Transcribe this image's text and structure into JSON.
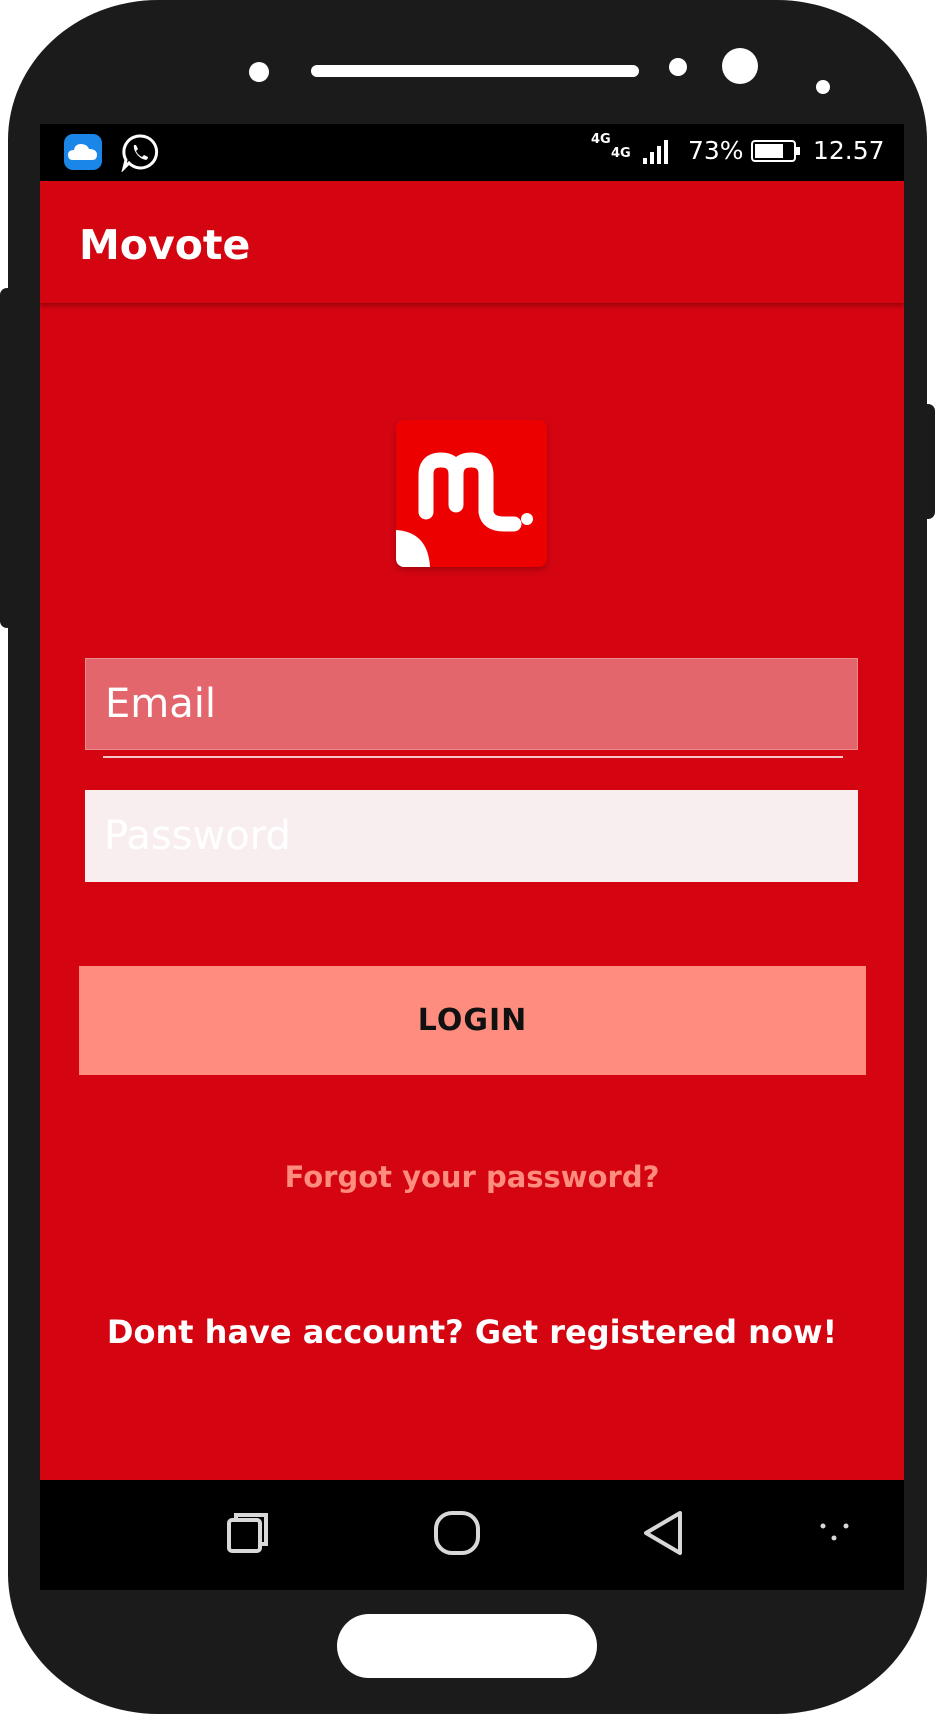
{
  "status_bar": {
    "network_primary": "4G",
    "network_secondary": "4G",
    "battery_percent": "73%",
    "time": "12.57",
    "left_icons": [
      "cloud-icon",
      "whatsapp-icon"
    ]
  },
  "app_bar": {
    "title": "Movote"
  },
  "logo": {
    "icon": "movote-logo-icon"
  },
  "login_form": {
    "email_placeholder": "Email",
    "password_placeholder": "Password",
    "login_label": "LOGIN",
    "forgot_password": "Forgot your password?",
    "register_prompt": "Dont have account? Get registered now!"
  },
  "nav_bar": {
    "buttons": [
      "recents-icon",
      "home-icon",
      "back-icon",
      "menu-dots-icon"
    ]
  },
  "colors": {
    "primary": "#d40511",
    "accent": "#ff8d7f",
    "logo_background": "#ec0000"
  }
}
